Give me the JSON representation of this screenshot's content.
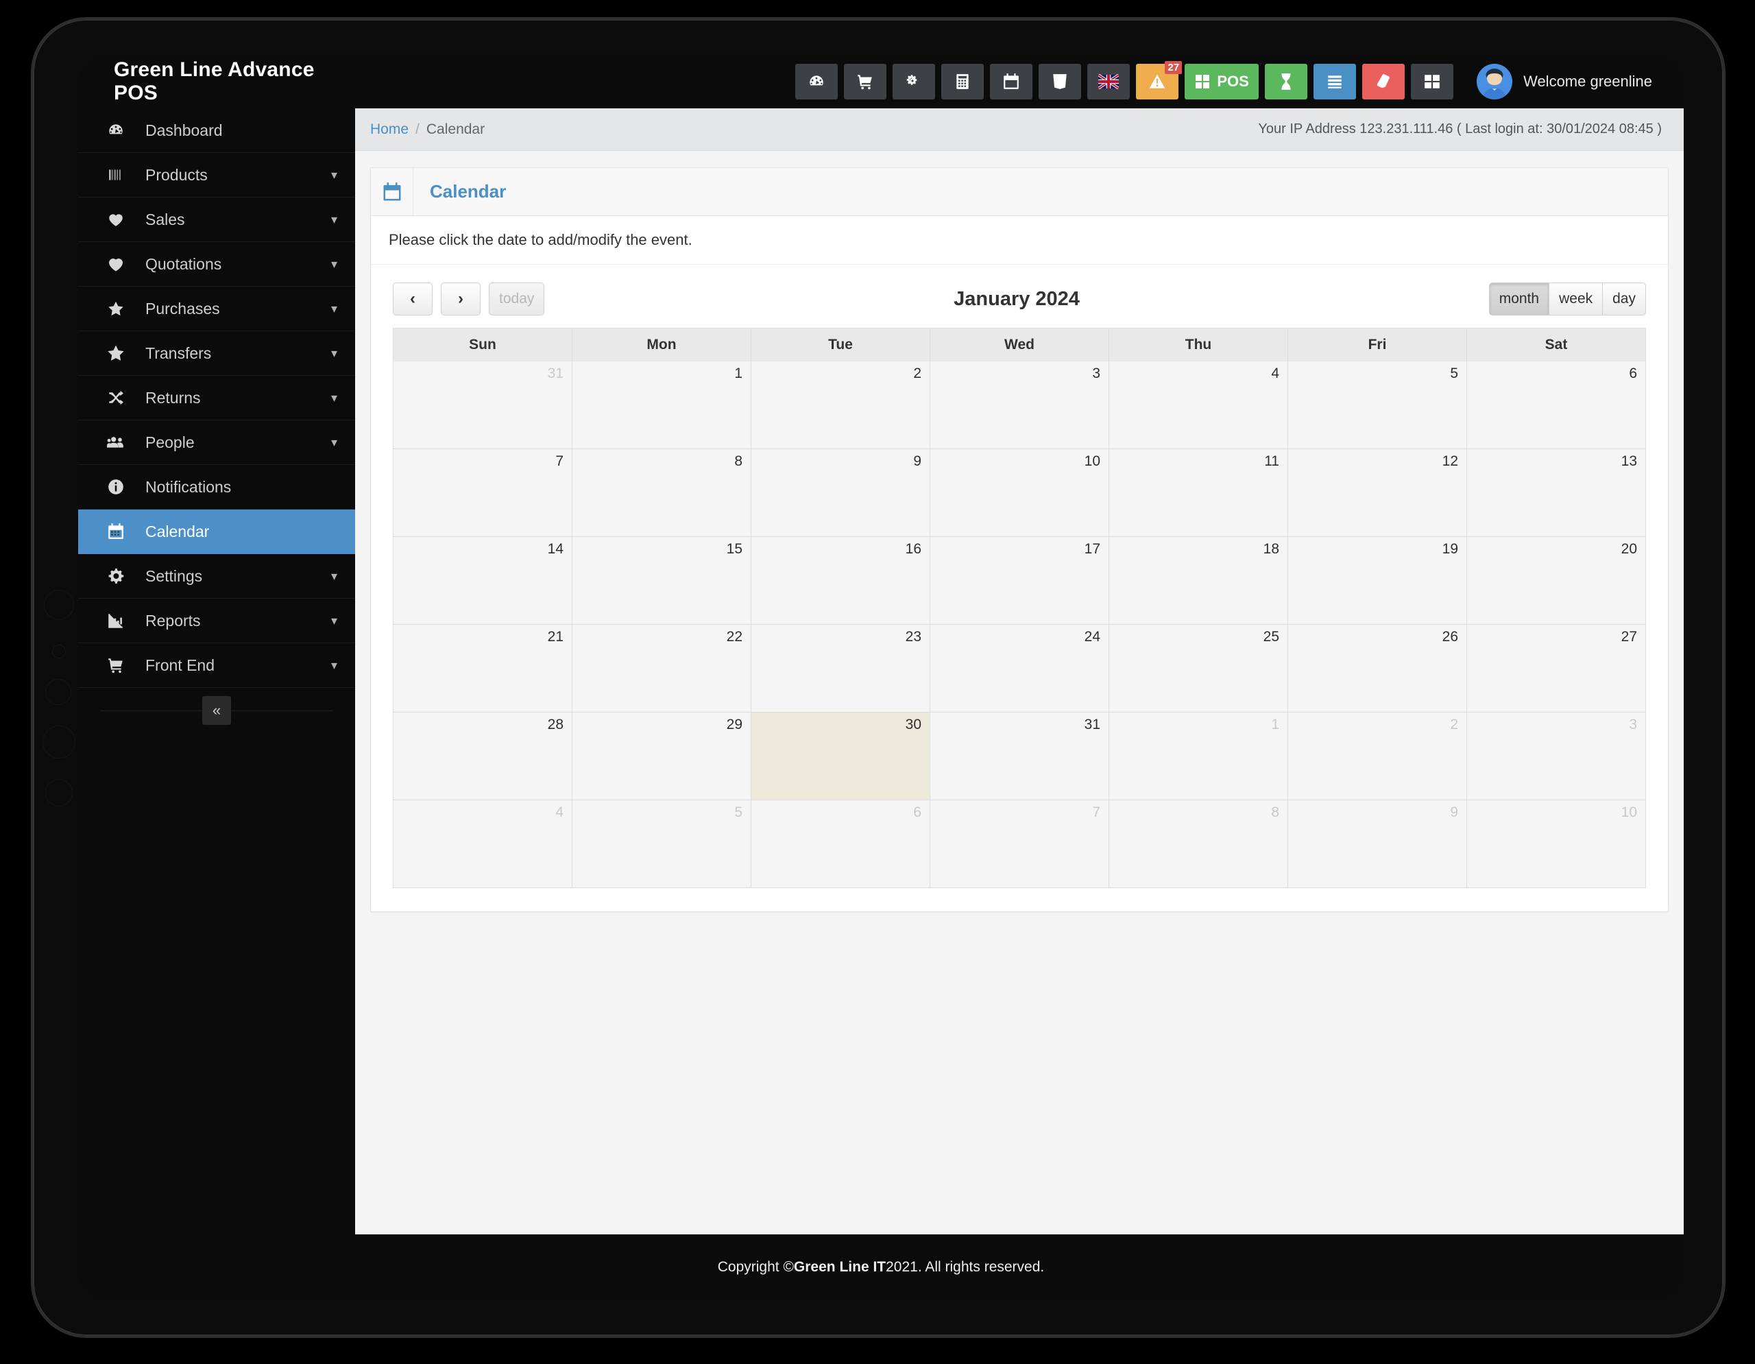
{
  "app": {
    "brand": "Green Line Advance POS",
    "welcome": "Welcome greenline"
  },
  "topnav": {
    "items": [
      {
        "name": "dashboard-icon",
        "label": "",
        "style": "dark"
      },
      {
        "name": "cart-icon",
        "label": "",
        "style": "dark"
      },
      {
        "name": "gears-icon",
        "label": "",
        "style": "dark"
      },
      {
        "name": "calculator-icon",
        "label": "",
        "style": "dark"
      },
      {
        "name": "calendar-icon",
        "label": "",
        "style": "dark"
      },
      {
        "name": "css3-icon",
        "label": "",
        "style": "dark"
      },
      {
        "name": "uk-flag-icon",
        "label": "",
        "style": "dark"
      },
      {
        "name": "warning-icon",
        "label": "",
        "style": "warn",
        "badge": "27"
      },
      {
        "name": "pos-icon",
        "label": "POS",
        "style": "pos"
      },
      {
        "name": "hourglass-icon",
        "label": "",
        "style": "green"
      },
      {
        "name": "list-icon",
        "label": "",
        "style": "blue"
      },
      {
        "name": "eraser-icon",
        "label": "",
        "style": "red"
      },
      {
        "name": "grid-icon",
        "label": "",
        "style": "dark"
      }
    ]
  },
  "sidebar": {
    "collapse_label": "«",
    "items": [
      {
        "label": "Dashboard",
        "icon": "dashboard-icon",
        "caret": false,
        "active": false
      },
      {
        "label": "Products",
        "icon": "barcode-icon",
        "caret": true,
        "active": false
      },
      {
        "label": "Sales",
        "icon": "heart-filled-icon",
        "caret": true,
        "active": false
      },
      {
        "label": "Quotations",
        "icon": "heart-outline-icon",
        "caret": true,
        "active": false
      },
      {
        "label": "Purchases",
        "icon": "star-filled-icon",
        "caret": true,
        "active": false
      },
      {
        "label": "Transfers",
        "icon": "star-outline-icon",
        "caret": true,
        "active": false
      },
      {
        "label": "Returns",
        "icon": "shuffle-icon",
        "caret": true,
        "active": false
      },
      {
        "label": "People",
        "icon": "users-icon",
        "caret": true,
        "active": false
      },
      {
        "label": "Notifications",
        "icon": "info-icon",
        "caret": false,
        "active": false
      },
      {
        "label": "Calendar",
        "icon": "calendar-icon",
        "caret": false,
        "active": true
      },
      {
        "label": "Settings",
        "icon": "gear-icon",
        "caret": true,
        "active": false
      },
      {
        "label": "Reports",
        "icon": "bar-chart-icon",
        "caret": true,
        "active": false
      },
      {
        "label": "Front End",
        "icon": "cart-icon",
        "caret": true,
        "active": false
      }
    ]
  },
  "breadcrumb": {
    "home": "Home",
    "separator": "/",
    "current": "Calendar"
  },
  "ipinfo": "Your IP Address 123.231.111.46 ( Last login at: 30/01/2024 08:45 )",
  "panel": {
    "title": "Calendar",
    "note": "Please click the date to add/modify the event."
  },
  "calendar": {
    "prev_label": "‹",
    "next_label": "›",
    "today_label": "today",
    "today_disabled": true,
    "title": "January 2024",
    "views": [
      {
        "label": "month",
        "active": true
      },
      {
        "label": "week",
        "active": false
      },
      {
        "label": "day",
        "active": false
      }
    ],
    "weekdays": [
      "Sun",
      "Mon",
      "Tue",
      "Wed",
      "Thu",
      "Fri",
      "Sat"
    ],
    "weeks": [
      [
        {
          "d": "31",
          "other": true,
          "today": false
        },
        {
          "d": "1",
          "other": false,
          "today": false
        },
        {
          "d": "2",
          "other": false,
          "today": false
        },
        {
          "d": "3",
          "other": false,
          "today": false
        },
        {
          "d": "4",
          "other": false,
          "today": false
        },
        {
          "d": "5",
          "other": false,
          "today": false
        },
        {
          "d": "6",
          "other": false,
          "today": false
        }
      ],
      [
        {
          "d": "7",
          "other": false,
          "today": false
        },
        {
          "d": "8",
          "other": false,
          "today": false
        },
        {
          "d": "9",
          "other": false,
          "today": false
        },
        {
          "d": "10",
          "other": false,
          "today": false
        },
        {
          "d": "11",
          "other": false,
          "today": false
        },
        {
          "d": "12",
          "other": false,
          "today": false
        },
        {
          "d": "13",
          "other": false,
          "today": false
        }
      ],
      [
        {
          "d": "14",
          "other": false,
          "today": false
        },
        {
          "d": "15",
          "other": false,
          "today": false
        },
        {
          "d": "16",
          "other": false,
          "today": false
        },
        {
          "d": "17",
          "other": false,
          "today": false
        },
        {
          "d": "18",
          "other": false,
          "today": false
        },
        {
          "d": "19",
          "other": false,
          "today": false
        },
        {
          "d": "20",
          "other": false,
          "today": false
        }
      ],
      [
        {
          "d": "21",
          "other": false,
          "today": false
        },
        {
          "d": "22",
          "other": false,
          "today": false
        },
        {
          "d": "23",
          "other": false,
          "today": false
        },
        {
          "d": "24",
          "other": false,
          "today": false
        },
        {
          "d": "25",
          "other": false,
          "today": false
        },
        {
          "d": "26",
          "other": false,
          "today": false
        },
        {
          "d": "27",
          "other": false,
          "today": false
        }
      ],
      [
        {
          "d": "28",
          "other": false,
          "today": false
        },
        {
          "d": "29",
          "other": false,
          "today": false
        },
        {
          "d": "30",
          "other": false,
          "today": true
        },
        {
          "d": "31",
          "other": false,
          "today": false
        },
        {
          "d": "1",
          "other": true,
          "today": false
        },
        {
          "d": "2",
          "other": true,
          "today": false
        },
        {
          "d": "3",
          "other": true,
          "today": false
        }
      ],
      [
        {
          "d": "4",
          "other": true,
          "today": false
        },
        {
          "d": "5",
          "other": true,
          "today": false
        },
        {
          "d": "6",
          "other": true,
          "today": false
        },
        {
          "d": "7",
          "other": true,
          "today": false
        },
        {
          "d": "8",
          "other": true,
          "today": false
        },
        {
          "d": "9",
          "other": true,
          "today": false
        },
        {
          "d": "10",
          "other": true,
          "today": false
        }
      ]
    ]
  },
  "footer": {
    "prefix": "Copyright © ",
    "company": "Green Line IT",
    "suffix": " 2021. All rights reserved."
  },
  "colors": {
    "accent": "#4d90c9",
    "sidebar_bg": "#0b0b0b",
    "warn": "#f0ad4e",
    "green": "#5cb85c",
    "red": "#ec5f5f",
    "today_cell": "#eeeadb"
  }
}
